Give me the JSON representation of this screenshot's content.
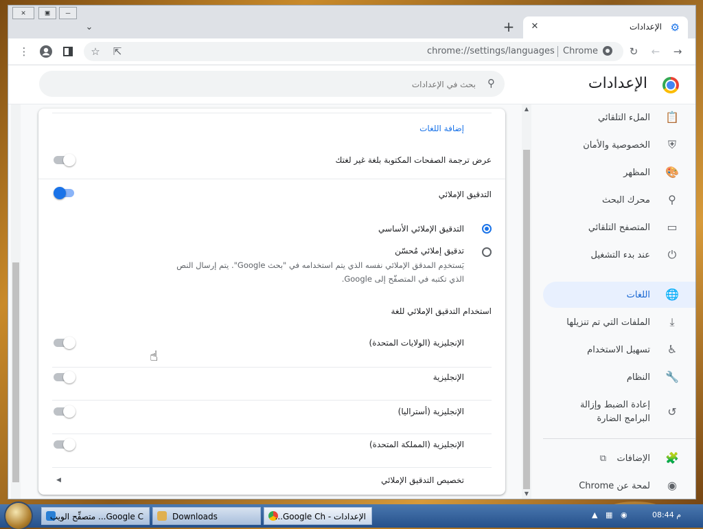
{
  "window": {
    "controls": [
      "✕",
      "▣",
      "—"
    ],
    "tab": {
      "title": "الإعدادات",
      "close": "✕"
    },
    "new_tab": "+",
    "tab_dropdown": "⌄"
  },
  "toolbar": {
    "url": "chrome://settings/languages",
    "chrome_label": "Chrome"
  },
  "header": {
    "title": "الإعدادات",
    "search_placeholder": "بحث في الإعدادات"
  },
  "sidebar": {
    "items": [
      {
        "label": "الملء التلقائي",
        "icon": "clipboard-icon"
      },
      {
        "label": "الخصوصية والأمان",
        "icon": "shield-icon"
      },
      {
        "label": "المظهر",
        "icon": "palette-icon"
      },
      {
        "label": "محرك البحث",
        "icon": "search-icon"
      },
      {
        "label": "المتصفح التلقائي",
        "icon": "browser-icon"
      },
      {
        "label": "عند بدء التشغيل",
        "icon": "power-icon"
      },
      {
        "label": "اللغات",
        "icon": "globe-icon",
        "active": true
      },
      {
        "label": "الملفات التي تم تنزيلها",
        "icon": "download-icon"
      },
      {
        "label": "تسهيل الاستخدام",
        "icon": "accessibility-icon"
      },
      {
        "label": "النظام",
        "icon": "wrench-icon"
      },
      {
        "label": "إعادة الضبط وإزالة البرامج الضارة",
        "icon": "restore-icon"
      },
      {
        "label": "الإضافات",
        "icon": "puzzle-icon"
      },
      {
        "label": "لمحة عن Chrome",
        "icon": "chrome-icon"
      }
    ]
  },
  "languages": {
    "add_languages": "إضافة اللغات",
    "offer_translate": "عرض ترجمة الصفحات المكتوبة بلغة غير لغتك",
    "spell_check": "التدقيق الإملائي",
    "basic_spell_check": "التدقيق الإملائي الأساسي",
    "enhanced_spell_check": "تدقيق إملائي مُحسّن",
    "enhanced_desc": "يَستخدِم المدقق الإملائي نفسه الذي يتم استخدامه في \"بحث Google\". يتم إرسال النص الذي تكتبه في المتصفّح إلى Google.",
    "use_spell_check_for": "استخدام التدقيق الإملائي للغة",
    "spell_languages": [
      "الإنجليزية (الولايات المتحدة)",
      "الإنجليزية",
      "الإنجليزية (أستراليا)",
      "الإنجليزية (المملكة المتحدة)"
    ],
    "customize_spell_check": "تخصيص التدقيق الإملائي",
    "toggles": {
      "offer_translate": false,
      "spell_check": true
    }
  },
  "taskbar": {
    "tasks": [
      "Google C... متصفِّح الويب",
      "Downloads",
      "الإعدادات - Google Ch..."
    ],
    "clock": "08:44 م"
  },
  "colors": {
    "accent": "#1a73e8",
    "active_bg": "#e8f0fe"
  }
}
